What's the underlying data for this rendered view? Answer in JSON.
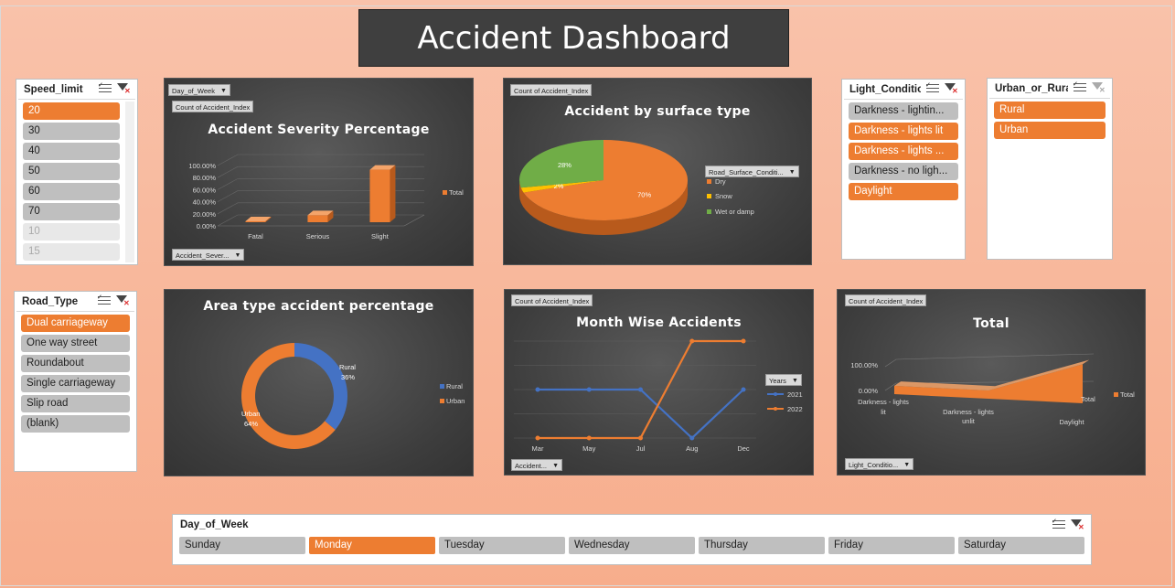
{
  "title": "Accident Dashboard",
  "colors": {
    "accent": "#ed7d31",
    "blue": "#4472c4",
    "green": "#70ad47",
    "yellow": "#ffc000"
  },
  "speed_slicer": {
    "title": "Speed_limit",
    "items": [
      {
        "label": "20",
        "state": "selected"
      },
      {
        "label": "30",
        "state": "normal"
      },
      {
        "label": "40",
        "state": "normal"
      },
      {
        "label": "50",
        "state": "normal"
      },
      {
        "label": "60",
        "state": "normal"
      },
      {
        "label": "70",
        "state": "normal"
      },
      {
        "label": "10",
        "state": "disabled"
      },
      {
        "label": "15",
        "state": "disabled"
      }
    ]
  },
  "road_slicer": {
    "title": "Road_Type",
    "items": [
      {
        "label": "Dual carriageway",
        "state": "selected"
      },
      {
        "label": "One way street",
        "state": "normal"
      },
      {
        "label": "Roundabout",
        "state": "normal"
      },
      {
        "label": "Single carriageway",
        "state": "normal"
      },
      {
        "label": "Slip road",
        "state": "normal"
      },
      {
        "label": "(blank)",
        "state": "normal"
      }
    ]
  },
  "light_slicer": {
    "title": "Light_Conditions",
    "items": [
      {
        "label": "Darkness - lightin...",
        "state": "normal"
      },
      {
        "label": "Darkness - lights lit",
        "state": "selected"
      },
      {
        "label": "Darkness - lights ...",
        "state": "selected"
      },
      {
        "label": "Darkness - no ligh...",
        "state": "normal"
      },
      {
        "label": "Daylight",
        "state": "selected"
      }
    ]
  },
  "urban_slicer": {
    "title": "Urban_or_Rura...",
    "items": [
      {
        "label": "Rural",
        "state": "selected"
      },
      {
        "label": "Urban",
        "state": "selected"
      }
    ]
  },
  "day_slicer": {
    "title": "Day_of_Week",
    "items": [
      {
        "label": "Sunday",
        "state": "normal"
      },
      {
        "label": "Monday",
        "state": "selected"
      },
      {
        "label": "Tuesday",
        "state": "normal"
      },
      {
        "label": "Wednesday",
        "state": "normal"
      },
      {
        "label": "Thursday",
        "state": "normal"
      },
      {
        "label": "Friday",
        "state": "normal"
      },
      {
        "label": "Saturday",
        "state": "normal"
      }
    ]
  },
  "severity": {
    "filter_tag": "Day_of_Week",
    "value_tag": "Count of Accident_Index",
    "axis_tag": "Accident_Sever...",
    "legend": "Total",
    "yticks": [
      "100.00%",
      "80.00%",
      "60.00%",
      "40.00%",
      "20.00%",
      "0.00%"
    ]
  },
  "surface": {
    "value_tag": "Count of Accident_Index",
    "legend_tag": "Road_Surface_Conditi...",
    "slice_labels": [
      "70%",
      "2%",
      "28%"
    ]
  },
  "area": {
    "legend_a": "Rural",
    "legend_b": "Urban",
    "label_rural": "Rural",
    "pct_rural": "36%",
    "label_urban": "Urban",
    "pct_urban": "64%"
  },
  "month": {
    "value_tag": "Count of Accident_Index",
    "axis_tag": "Accident...",
    "legend_tag": "Years"
  },
  "total": {
    "value_tag": "Count of Accident_Index",
    "axis_tag": "Light_Conditio...",
    "legend": "Total",
    "series_label": "Total",
    "ytick_top": "100.00%",
    "ytick_bottom": "0.00%",
    "cat1_a": "Darkness - lights",
    "cat1_b": "lit",
    "cat2_a": "Darkness - lights",
    "cat2_b": "unlit",
    "cat3": "Daylight"
  },
  "chart_data": [
    {
      "type": "bar",
      "title": "Accident Severity Percentage",
      "categories": [
        "Fatal",
        "Serious",
        "Slight"
      ],
      "series": [
        {
          "name": "Total",
          "values": [
            1.5,
            11.5,
            87
          ]
        }
      ],
      "ylim": [
        0,
        100
      ],
      "yunit": "%"
    },
    {
      "type": "pie",
      "title": "Accident by surface type",
      "categories": [
        "Dry",
        "Snow",
        "Wet or damp"
      ],
      "values": [
        70,
        2,
        28
      ]
    },
    {
      "type": "pie",
      "title": "Area type accident percentage",
      "categories": [
        "Rural",
        "Urban"
      ],
      "values": [
        36,
        64
      ]
    },
    {
      "type": "line",
      "title": "Month Wise Accidents",
      "categories": [
        "Mar",
        "May",
        "Jul",
        "Aug",
        "Dec"
      ],
      "series": [
        {
          "name": "2021",
          "values": [
            2,
            2,
            2,
            0,
            2
          ]
        },
        {
          "name": "2022",
          "values": [
            0,
            0,
            0,
            4,
            4
          ]
        }
      ]
    },
    {
      "type": "area",
      "title": "Total",
      "categories": [
        "Darkness - lights lit",
        "Darkness - lights unlit",
        "Daylight"
      ],
      "series": [
        {
          "name": "Total",
          "values": [
            15,
            0,
            85
          ]
        }
      ],
      "ylim": [
        0,
        100
      ],
      "yunit": "%"
    }
  ]
}
